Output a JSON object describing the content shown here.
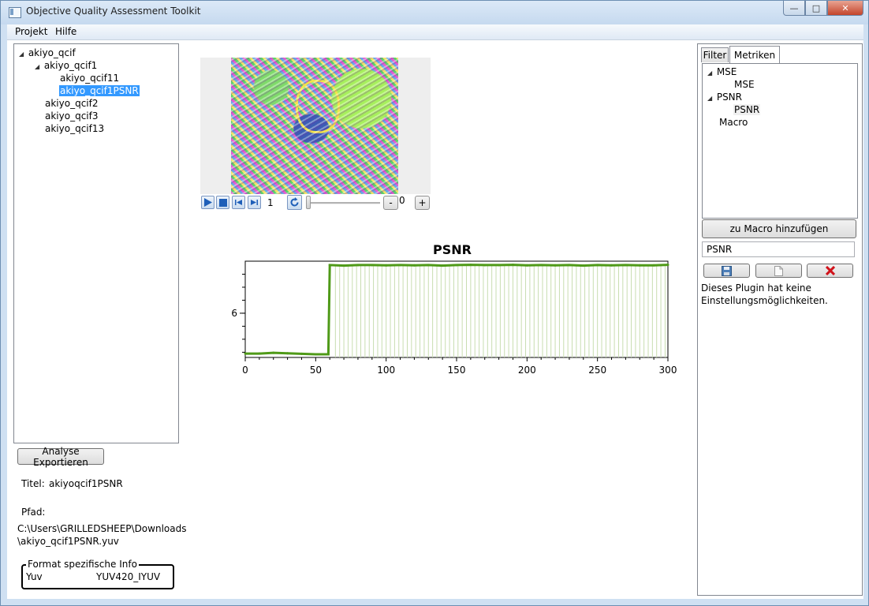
{
  "window": {
    "title": "Objective Quality Assessment Toolkit"
  },
  "menu": {
    "items": [
      "Projekt",
      "Hilfe"
    ]
  },
  "project_tree": {
    "root": "akiyo_qcif",
    "child": "akiyo_qcif1",
    "grandchildren": [
      "akiyo_qcif11",
      "akiyo_qcif1PSNR"
    ],
    "siblings": [
      "akiyo_qcif2",
      "akiyo_qcif3",
      "akiyo_qcif13"
    ]
  },
  "export_button": "Analyse Exportieren",
  "details": {
    "title_label": "Titel:",
    "title_value": "akiyoqcif1PSNR",
    "path_label": "Pfad:",
    "path_line1": "C:\\Users\\GRILLEDSHEEP\\Downloads",
    "path_line2": "\\akiyo_qcif1PSNR.yuv",
    "format_legend": "Format spezifische Info",
    "format_key": "Yuv",
    "format_value": "YUV420_IYUV"
  },
  "player": {
    "frame": "1",
    "slider_value": "0",
    "minus": "-",
    "plus": "+",
    "icons": [
      "play-icon",
      "stop-icon",
      "previous-frame-icon",
      "next-frame-icon",
      "repeat-icon"
    ]
  },
  "chart_data": {
    "type": "line",
    "title": "PSNR",
    "xlabel": "",
    "ylabel": "",
    "xlim": [
      0,
      300
    ],
    "x_ticks": [
      0,
      50,
      100,
      150,
      200,
      250,
      300
    ],
    "y_ticks": [
      6
    ],
    "ylim": [
      4.3,
      8.0
    ],
    "series": [
      {
        "name": "",
        "x": [
          0,
          10,
          20,
          30,
          40,
          50,
          59,
          60,
          70,
          80,
          90,
          100,
          110,
          120,
          130,
          140,
          150,
          160,
          170,
          180,
          190,
          200,
          210,
          220,
          230,
          240,
          250,
          260,
          270,
          280,
          290,
          300
        ],
        "y": [
          4.45,
          4.45,
          4.48,
          4.46,
          4.44,
          4.42,
          4.42,
          7.85,
          7.83,
          7.85,
          7.85,
          7.84,
          7.85,
          7.84,
          7.85,
          7.83,
          7.85,
          7.86,
          7.85,
          7.85,
          7.86,
          7.84,
          7.85,
          7.84,
          7.85,
          7.83,
          7.85,
          7.84,
          7.85,
          7.84,
          7.84,
          7.86
        ]
      }
    ],
    "colors": {
      "line": "#4f9a18",
      "grid": "#c8ddb0"
    }
  },
  "right_panel": {
    "tabs": [
      "Filter",
      "Metriken"
    ],
    "active_tab": "Metriken",
    "metrics": [
      {
        "label": "MSE",
        "children": [
          "MSE"
        ]
      },
      {
        "label": "PSNR",
        "children": [
          "PSNR"
        ]
      },
      {
        "label": "Macro",
        "children": []
      }
    ],
    "add_macro_button": "zu Macro hinzufügen",
    "name_field_value": "PSNR",
    "actions": [
      "save-icon",
      "new-document-icon",
      "delete-icon"
    ],
    "info_text_line1": "Dieses Plugin hat keine",
    "info_text_line2": "Einstellungsmöglichkeiten."
  }
}
